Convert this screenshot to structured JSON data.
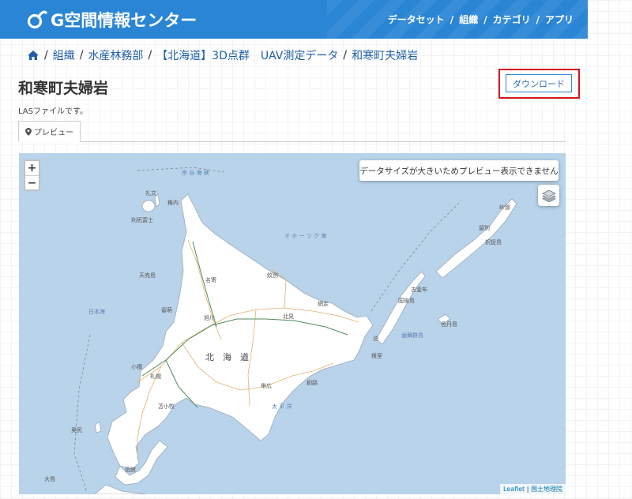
{
  "header": {
    "logo_text": "G空間情報センター",
    "nav": [
      {
        "label": "データセット"
      },
      {
        "label": "組織"
      },
      {
        "label": "カテゴリ"
      },
      {
        "label": "アプリ"
      }
    ],
    "nav_separator": "/"
  },
  "breadcrumb": {
    "separator": "/",
    "items": [
      {
        "label": "組織"
      },
      {
        "label": "水産林務部"
      },
      {
        "label": "【北海道】3D点群　UAV測定データ"
      },
      {
        "label": "和寒町夫婦岩"
      }
    ]
  },
  "page": {
    "title": "和寒町夫婦岩",
    "description": "LASファイルです。",
    "download_label": "ダウンロード"
  },
  "tabs": [
    {
      "label": "プレビュー",
      "icon": "map-marker-icon",
      "active": true
    }
  ],
  "map": {
    "zoom_in": "+",
    "zoom_out": "−",
    "notice": "データサイズが大きいためプレビュー表示できません",
    "attribution": {
      "leaflet": "Leaflet",
      "divider": "|",
      "source": "国土地理院"
    },
    "labels": {
      "hokkaido": "北　海　道",
      "sapporo": "札幌",
      "asahikawa": "旭川",
      "kushiro": "釧路",
      "obihiro": "帯広",
      "hakodate": "函館",
      "abashiri": "網走",
      "nemuro": "根室",
      "wakkanai": "稚内",
      "rumoi": "留萌",
      "kitami": "北見",
      "monbetsu": "紋別",
      "nayoro": "名寄",
      "otaru": "小樽",
      "tomakomai": "苫小牧",
      "rishiri": "利尻富士",
      "rebun": "礼文",
      "okushiri": "奥尻",
      "oshima": "大島",
      "tenbai": "天売島",
      "habomai": "歯舞群島",
      "shikotan": "色丹島",
      "etorofu": "択捉島",
      "kunashiri": "国後島",
      "ruyobetsu": "留別",
      "shana": "紗那",
      "furukamappu": "古釜布",
      "tomari": "泊",
      "sea_okhotsk": "オ ホ ー ツ ク 海",
      "japan_sea": "日本海",
      "pacific": "太 平 洋",
      "soya": "宗 谷 海 峡"
    }
  },
  "colors": {
    "header_bg": "#2a86d4",
    "link": "#1f5fa8",
    "highlight_box": "#d9141b",
    "sea": "#b9d3ea",
    "land": "#ffffff"
  }
}
